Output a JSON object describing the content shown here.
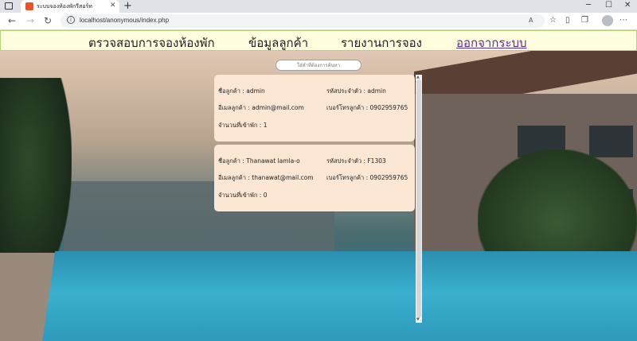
{
  "browser": {
    "tab_title": "ระบบจองห้องพักรีสอร์ท",
    "url": "localhost/anonymous/index.php"
  },
  "nav": {
    "check_booking": "ตรวจสอบการจองห้องพัก",
    "customer_info": "ข้อมูลลูกค้า",
    "booking_report": "รายงานการจอง",
    "logout": "ออกจากระบบ"
  },
  "search": {
    "placeholder": "ใส่คำที่ต้องการค้นหา"
  },
  "labels": {
    "name": "ชื่อลูกค้า",
    "id": "รหัสประจำตัว",
    "email": "อีเมลลูกค้า",
    "phone": "เบอร์โทรลูกค้า",
    "stay_count": "จำนวนที่เข้าพัก"
  },
  "customers": [
    {
      "name": "admin",
      "id": "admin",
      "email": "admin@mail.com",
      "phone": "0902959765",
      "stay_count": "1"
    },
    {
      "name": "Thanawat lamla-o",
      "id": "F1303",
      "email": "thanawat@mail.com",
      "phone": "0902959765",
      "stay_count": "0"
    }
  ]
}
